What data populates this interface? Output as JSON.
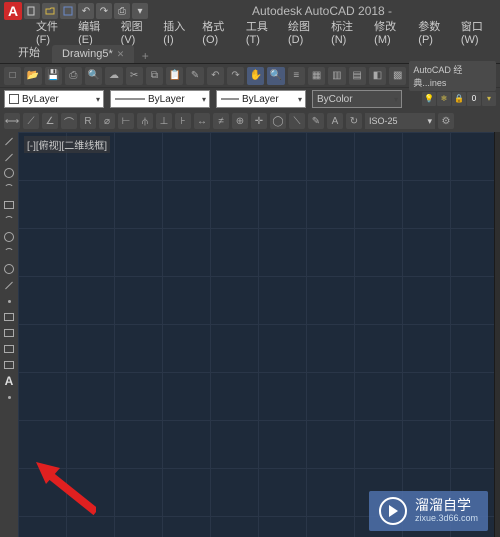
{
  "title": "Autodesk AutoCAD 2018 -",
  "menus": [
    "文件(F)",
    "编辑(E)",
    "视图(V)",
    "插入(I)",
    "格式(O)",
    "工具(T)",
    "绘图(D)",
    "标注(N)",
    "修改(M)",
    "参数(P)",
    "窗口(W)"
  ],
  "tabs": {
    "start": "开始",
    "doc": "Drawing5*",
    "plus": "+"
  },
  "workspace": "AutoCAD 经典...ines",
  "props": {
    "layer": "ByLayer",
    "lt": "ByLayer",
    "lw": "ByLayer",
    "color": "ByColor"
  },
  "dimstyle": "ISO-25",
  "view_label": "[-][俯视][二维线框]",
  "left_tools": [
    {
      "name": "line-tool",
      "glyph": "line"
    },
    {
      "name": "polyline-tool",
      "glyph": "line"
    },
    {
      "name": "circle-tool",
      "glyph": "circ"
    },
    {
      "name": "arc-tool",
      "glyph": "arc"
    },
    {
      "name": "rectangle-tool",
      "glyph": "rect"
    },
    {
      "name": "spline-tool",
      "glyph": "arc"
    },
    {
      "name": "ellipse-tool",
      "glyph": "circ"
    },
    {
      "name": "ellipse-arc-tool",
      "glyph": "arc"
    },
    {
      "name": "revision-cloud-tool",
      "glyph": "circ"
    },
    {
      "name": "ray-tool",
      "glyph": "line"
    },
    {
      "name": "point-tool",
      "glyph": ""
    },
    {
      "name": "hatch-tool",
      "glyph": "rect"
    },
    {
      "name": "gradient-tool",
      "glyph": "rect"
    },
    {
      "name": "region-tool",
      "glyph": "rect"
    },
    {
      "name": "table-tool",
      "glyph": "rect"
    },
    {
      "name": "text-tool",
      "glyph": "A"
    },
    {
      "name": "addselect-tool",
      "glyph": ""
    }
  ],
  "watermark": {
    "title": "溜溜自学",
    "url": "zixue.3d66.com"
  }
}
